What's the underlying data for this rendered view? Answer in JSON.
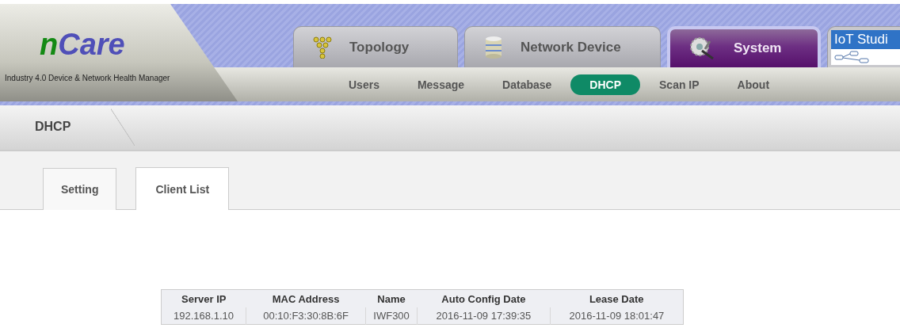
{
  "logo": {
    "brand_1": "n",
    "brand_2": "Care",
    "tagline": "Industry 4.0 Device & Network Health Manager"
  },
  "main_tabs": [
    {
      "label": "Topology",
      "kind": "topology",
      "selected": false
    },
    {
      "label": "Network Device",
      "kind": "database",
      "selected": false
    },
    {
      "label": "System",
      "kind": "system",
      "selected": true
    },
    {
      "label": "IoT Studi",
      "kind": "studio",
      "selected": false
    }
  ],
  "sub_menu": [
    {
      "label": "Users",
      "selected": false
    },
    {
      "label": "Message",
      "selected": false
    },
    {
      "label": "Database",
      "selected": false
    },
    {
      "label": "DHCP",
      "selected": true
    },
    {
      "label": "Scan IP",
      "selected": false
    },
    {
      "label": "About",
      "selected": false
    }
  ],
  "page_title": "DHCP",
  "tabs": [
    {
      "label": "Setting",
      "selected": false
    },
    {
      "label": "Client List",
      "selected": true
    }
  ],
  "table": {
    "columns": [
      "Server IP",
      "MAC Address",
      "Name",
      "Auto Config Date",
      "Lease Date"
    ],
    "rows": [
      [
        "192.168.1.10",
        "00:10:F3:30:8B:6F",
        "IWF300",
        "2016-11-09 17:39:35",
        "2016-11-09 18:01:47"
      ]
    ]
  }
}
